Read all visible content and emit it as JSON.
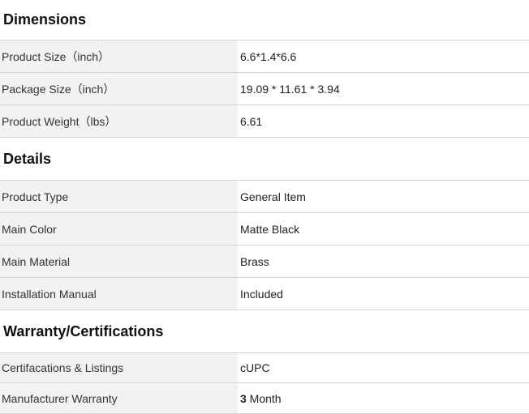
{
  "sections": [
    {
      "title": "Dimensions",
      "rows": [
        {
          "label": "Product Size（inch）",
          "value": "6.6*1.4*6.6"
        },
        {
          "label": "Package Size（inch）",
          "value": "19.09 * 11.61 * 3.94"
        },
        {
          "label": "Product Weight（lbs）",
          "value": "6.61"
        }
      ]
    },
    {
      "title": "Details",
      "rows": [
        {
          "label": "Product Type",
          "value": "General Item"
        },
        {
          "label": "Main Color",
          "value": "Matte Black"
        },
        {
          "label": "Main Material",
          "value": "Brass"
        },
        {
          "label": "Installation Manual",
          "value": "Included"
        }
      ]
    },
    {
      "title": "Warranty/Certifications",
      "rows": [
        {
          "label": "Certifacations & Listings",
          "value": "cUPC"
        },
        {
          "label": "Manufacturer Warranty",
          "value_number": "3",
          "value_unit": " Month"
        }
      ]
    }
  ]
}
